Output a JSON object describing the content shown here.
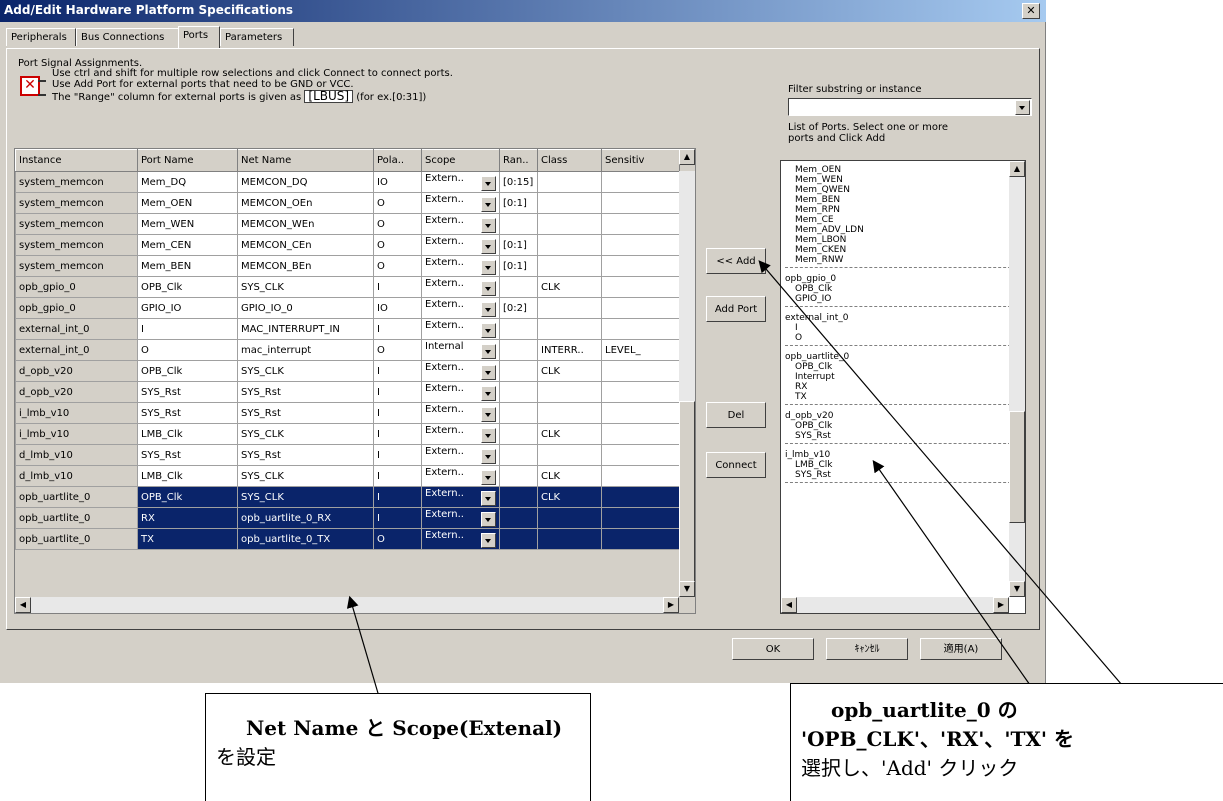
{
  "window": {
    "title": "Add/Edit Hardware Platform Specifications",
    "close_glyph": "✕"
  },
  "tabs": [
    {
      "label": "Peripherals"
    },
    {
      "label": "Bus Connections"
    },
    {
      "label": "Ports",
      "active": true
    },
    {
      "label": "Parameters"
    }
  ],
  "port_signal": {
    "group_label": "Port Signal Assignments.",
    "line1": "Use ctrl and shift for multiple row selections and click Connect to connect ports.",
    "line2": "Use Add Port for external ports that need to be GND or VCC.",
    "line3_a": "The \"Range\" column for external ports is given as",
    "range_example": "[LBUS]",
    "line3_b": "(for ex.[0:31])"
  },
  "table": {
    "columns": [
      "Instance",
      "Port Name",
      "Net Name",
      "Pola..",
      "Scope",
      "Ran..",
      "Class",
      "Sensitiv"
    ],
    "rows": [
      {
        "instance": "system_memcon",
        "port": "Mem_DQ",
        "net": "MEMCON_DQ",
        "pol": "IO",
        "scope": "Extern..",
        "range": "[0:15]",
        "class": "",
        "sens": "",
        "sel": false
      },
      {
        "instance": "system_memcon",
        "port": "Mem_OEN",
        "net": "MEMCON_OEn",
        "pol": "O",
        "scope": "Extern..",
        "range": "[0:1]",
        "class": "",
        "sens": "",
        "sel": false
      },
      {
        "instance": "system_memcon",
        "port": "Mem_WEN",
        "net": "MEMCON_WEn",
        "pol": "O",
        "scope": "Extern..",
        "range": "",
        "class": "",
        "sens": "",
        "sel": false
      },
      {
        "instance": "system_memcon",
        "port": "Mem_CEN",
        "net": "MEMCON_CEn",
        "pol": "O",
        "scope": "Extern..",
        "range": "[0:1]",
        "class": "",
        "sens": "",
        "sel": false
      },
      {
        "instance": "system_memcon",
        "port": "Mem_BEN",
        "net": "MEMCON_BEn",
        "pol": "O",
        "scope": "Extern..",
        "range": "[0:1]",
        "class": "",
        "sens": "",
        "sel": false
      },
      {
        "instance": "opb_gpio_0",
        "port": "OPB_Clk",
        "net": "SYS_CLK",
        "pol": "I",
        "scope": "Extern..",
        "range": "",
        "class": "CLK",
        "sens": "",
        "sel": false
      },
      {
        "instance": "opb_gpio_0",
        "port": "GPIO_IO",
        "net": "GPIO_IO_0",
        "pol": "IO",
        "scope": "Extern..",
        "range": "[0:2]",
        "class": "",
        "sens": "",
        "sel": false
      },
      {
        "instance": "external_int_0",
        "port": "I",
        "net": "MAC_INTERRUPT_IN",
        "pol": "I",
        "scope": "Extern..",
        "range": "",
        "class": "",
        "sens": "",
        "sel": false
      },
      {
        "instance": "external_int_0",
        "port": "O",
        "net": "mac_interrupt",
        "pol": "O",
        "scope": "Internal",
        "range": "",
        "class": "INTERR..",
        "sens": "LEVEL_",
        "sel": false
      },
      {
        "instance": "d_opb_v20",
        "port": "OPB_Clk",
        "net": "SYS_CLK",
        "pol": "I",
        "scope": "Extern..",
        "range": "",
        "class": "CLK",
        "sens": "",
        "sel": false
      },
      {
        "instance": "d_opb_v20",
        "port": "SYS_Rst",
        "net": "SYS_Rst",
        "pol": "I",
        "scope": "Extern..",
        "range": "",
        "class": "",
        "sens": "",
        "sel": false
      },
      {
        "instance": "i_lmb_v10",
        "port": "SYS_Rst",
        "net": "SYS_Rst",
        "pol": "I",
        "scope": "Extern..",
        "range": "",
        "class": "",
        "sens": "",
        "sel": false
      },
      {
        "instance": "i_lmb_v10",
        "port": "LMB_Clk",
        "net": "SYS_CLK",
        "pol": "I",
        "scope": "Extern..",
        "range": "",
        "class": "CLK",
        "sens": "",
        "sel": false
      },
      {
        "instance": "d_lmb_v10",
        "port": "SYS_Rst",
        "net": "SYS_Rst",
        "pol": "I",
        "scope": "Extern..",
        "range": "",
        "class": "",
        "sens": "",
        "sel": false
      },
      {
        "instance": "d_lmb_v10",
        "port": "LMB_Clk",
        "net": "SYS_CLK",
        "pol": "I",
        "scope": "Extern..",
        "range": "",
        "class": "CLK",
        "sens": "",
        "sel": false
      },
      {
        "instance": "opb_uartlite_0",
        "port": "OPB_Clk",
        "net": "SYS_CLK",
        "pol": "I",
        "scope": "Extern..",
        "range": "",
        "class": "CLK",
        "sens": "",
        "sel": true
      },
      {
        "instance": "opb_uartlite_0",
        "port": "RX",
        "net": "opb_uartlite_0_RX",
        "pol": "I",
        "scope": "Extern..",
        "range": "",
        "class": "",
        "sens": "",
        "sel": true
      },
      {
        "instance": "opb_uartlite_0",
        "port": "TX",
        "net": "opb_uartlite_0_TX",
        "pol": "O",
        "scope": "Extern..",
        "range": "",
        "class": "",
        "sens": "",
        "sel": true
      }
    ]
  },
  "buttons": {
    "add": "<< Add",
    "add_port": "Add Port",
    "del": "Del",
    "connect": "Connect",
    "ok": "OK",
    "cancel": "ｷｬﾝｾﾙ",
    "apply": "適用(A)"
  },
  "filter": {
    "label": "Filter substring or instance",
    "list_label": "List of Ports. Select one or more ports and Click Add"
  },
  "port_list": [
    {
      "name": "",
      "items": [
        "Mem_OEN",
        "Mem_WEN",
        "Mem_QWEN",
        "Mem_BEN",
        "Mem_RPN",
        "Mem_CE",
        "Mem_ADV_LDN",
        "Mem_LBON",
        "Mem_CKEN",
        "Mem_RNW"
      ]
    },
    {
      "name": "opb_gpio_0",
      "items": [
        "OPB_Clk",
        "GPIO_IO"
      ]
    },
    {
      "name": "external_int_0",
      "items": [
        "I",
        "O"
      ]
    },
    {
      "name": "opb_uartlite_0",
      "items": [
        "OPB_Clk",
        "Interrupt",
        "RX",
        "TX"
      ]
    },
    {
      "name": "d_opb_v20",
      "items": [
        "OPB_Clk",
        "SYS_Rst"
      ]
    },
    {
      "name": "i_lmb_v10",
      "items": [
        "LMB_Clk",
        "SYS_Rst"
      ]
    }
  ],
  "callouts": {
    "left_line1": "Net Name と Scope(Extenal)",
    "left_line2": "を設定",
    "right_line1": "opb_uartlite_0 の",
    "right_line2": "'OPB_CLK'、'RX'、'TX' を",
    "right_line3": "選択し、'Add' クリック"
  }
}
